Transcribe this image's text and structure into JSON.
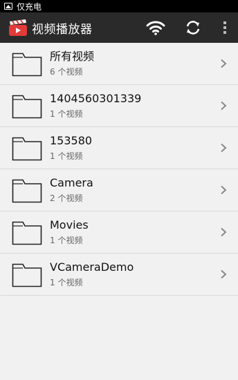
{
  "status_bar": {
    "text": "仅充电"
  },
  "action_bar": {
    "title": "视频播放器",
    "icons": [
      "app-clapperboard-icon",
      "wifi-icon",
      "refresh-icon",
      "overflow-menu-icon"
    ]
  },
  "folders": [
    {
      "name": "所有视频",
      "count": "6 个视频"
    },
    {
      "name": "1404560301339",
      "count": "1 个视频"
    },
    {
      "name": "153580",
      "count": "1 个视频"
    },
    {
      "name": "Camera",
      "count": "2 个视频"
    },
    {
      "name": "Movies",
      "count": "1 个视频"
    },
    {
      "name": "VCameraDemo",
      "count": "1 个视频"
    }
  ],
  "colors": {
    "action_bar_bg": "#2a2a2a",
    "status_bar_bg": "#000000",
    "list_bg": "#f1f1f1",
    "app_icon_red": "#e33a3a"
  }
}
